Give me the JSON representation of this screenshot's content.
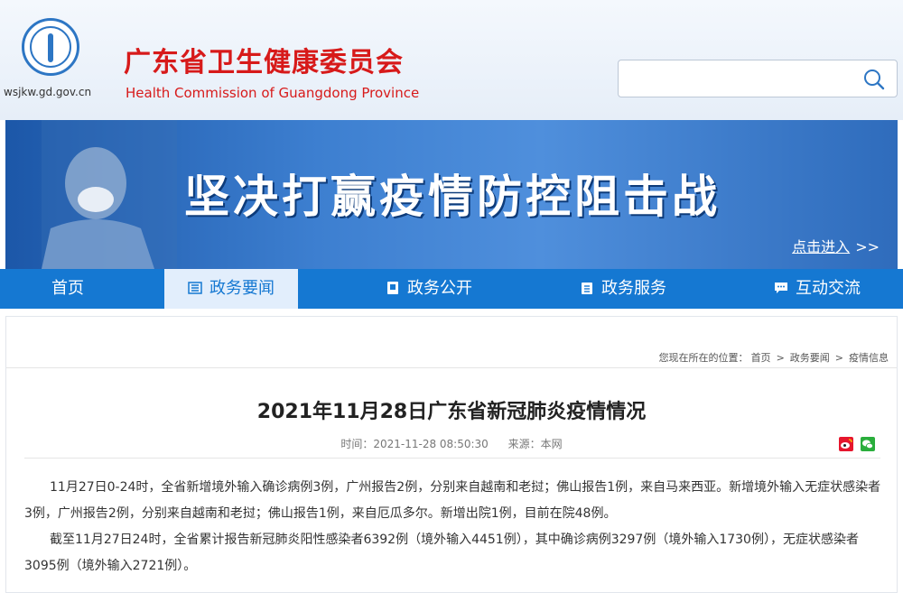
{
  "header": {
    "site_title": "广东省卫生健康委员会",
    "site_subtitle": "Health Commission of Guangdong Province",
    "domain": "wsjkw.gd.gov.cn",
    "search": {
      "placeholder": ""
    }
  },
  "banner": {
    "slogan": "坚决打赢疫情防控阻击战",
    "enter_label": "点击进入",
    "enter_arrows": ">>"
  },
  "nav": {
    "items": [
      {
        "label": "首页",
        "icon": "home",
        "active": false
      },
      {
        "label": "政务要闻",
        "icon": "news-icon",
        "active": true
      },
      {
        "label": "政务公开",
        "icon": "document-icon",
        "active": false
      },
      {
        "label": "政务服务",
        "icon": "clipboard-icon",
        "active": false
      },
      {
        "label": "互动交流",
        "icon": "chat-icon",
        "active": false
      }
    ]
  },
  "breadcrumb": {
    "prefix": "您现在所在的位置：",
    "items": [
      "首页",
      "政务要闻",
      "疫情信息"
    ],
    "separator": ">"
  },
  "article": {
    "title": "2021年11月28日广东省新冠肺炎疫情情况",
    "time": "时间：2021-11-28 08:50:30",
    "source": "来源：本网",
    "paragraphs": [
      "11月27日0-24时，全省新增境外输入确诊病例3例，广州报告2例，分别来自越南和老挝；佛山报告1例，来自马来西亚。新增境外输入无症状感染者3例，广州报告2例，分别来自越南和老挝；佛山报告1例，来自厄瓜多尔。新增出院1例，目前在院48例。",
      "截至11月27日24时，全省累计报告新冠肺炎阳性感染者6392例（境外输入4451例），其中确诊病例3297例（境外输入1730例），无症状感染者3095例（境外输入2721例）。"
    ]
  },
  "colors": {
    "brand_red": "#d71a1a",
    "nav_blue": "#1578d2",
    "nav_active_bg": "#e2eefc"
  }
}
